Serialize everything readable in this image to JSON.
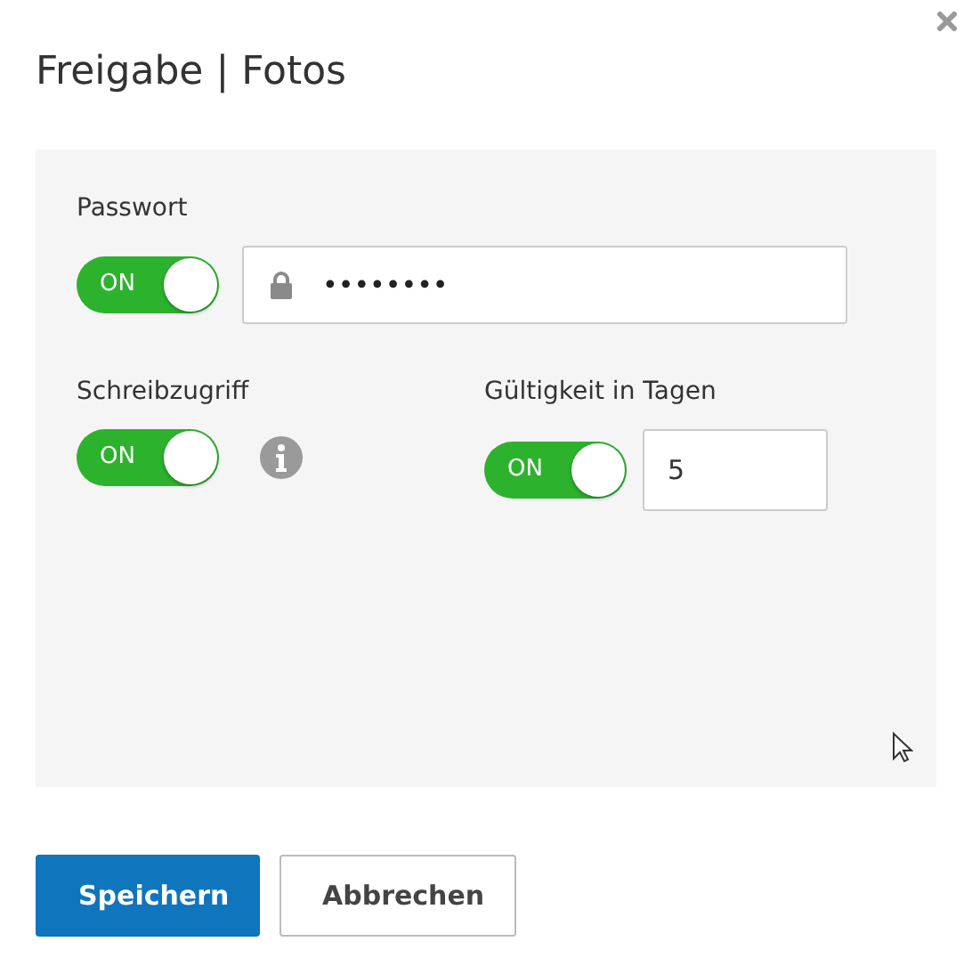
{
  "dialog": {
    "title": "Freigabe | Fotos"
  },
  "password": {
    "label": "Passwort",
    "toggle": {
      "label": "ON",
      "on": true
    },
    "value": "••••••••"
  },
  "write_access": {
    "label": "Schreibzugriff",
    "toggle": {
      "label": "ON",
      "on": true
    }
  },
  "validity": {
    "label": "Gültigkeit in Tagen",
    "toggle": {
      "label": "ON",
      "on": true
    },
    "value": "5"
  },
  "buttons": [
    {
      "label": "Speichern",
      "kind": "primary"
    },
    {
      "label": "Abbrechen",
      "kind": "secondary"
    }
  ]
}
